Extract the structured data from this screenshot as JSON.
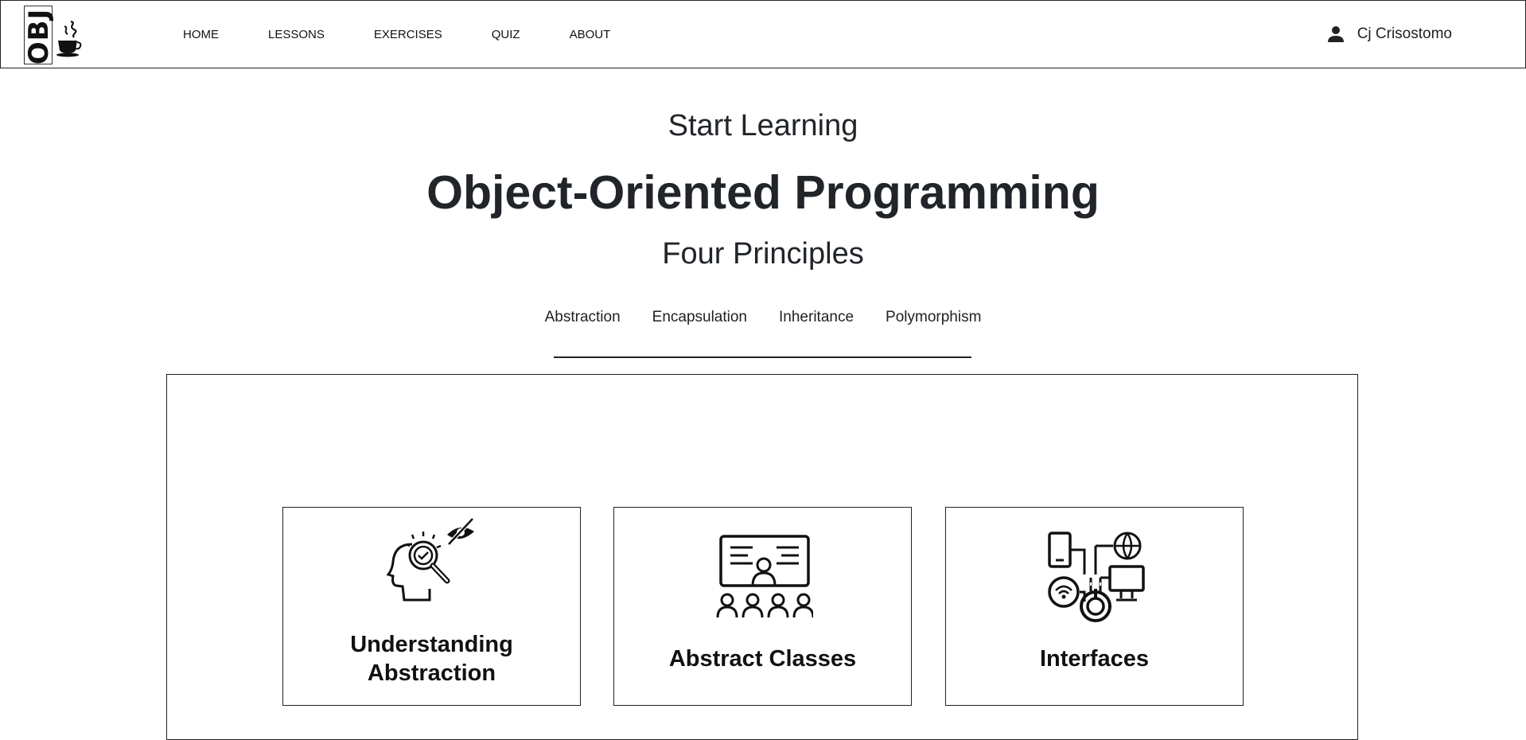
{
  "brand": {
    "logo_text": "OBJ"
  },
  "nav": {
    "links": [
      "HOME",
      "LESSONS",
      "EXERCISES",
      "QUIZ",
      "ABOUT"
    ],
    "user_name": "Cj Crisostomo"
  },
  "hero": {
    "subtitle": "Start Learning",
    "title": "Object-Oriented Programming",
    "principles_heading": "Four Principles"
  },
  "tabs": [
    "Abstraction",
    "Encapsulation",
    "Inheritance",
    "Polymorphism"
  ],
  "cards": [
    {
      "title_line1": "Understanding",
      "title_line2": "Abstraction",
      "icon": "head-magnifier-hidden-eye-icon"
    },
    {
      "title": "Abstract Classes",
      "icon": "classroom-presentation-icon"
    },
    {
      "title": "Interfaces",
      "icon": "connected-devices-icon"
    }
  ]
}
